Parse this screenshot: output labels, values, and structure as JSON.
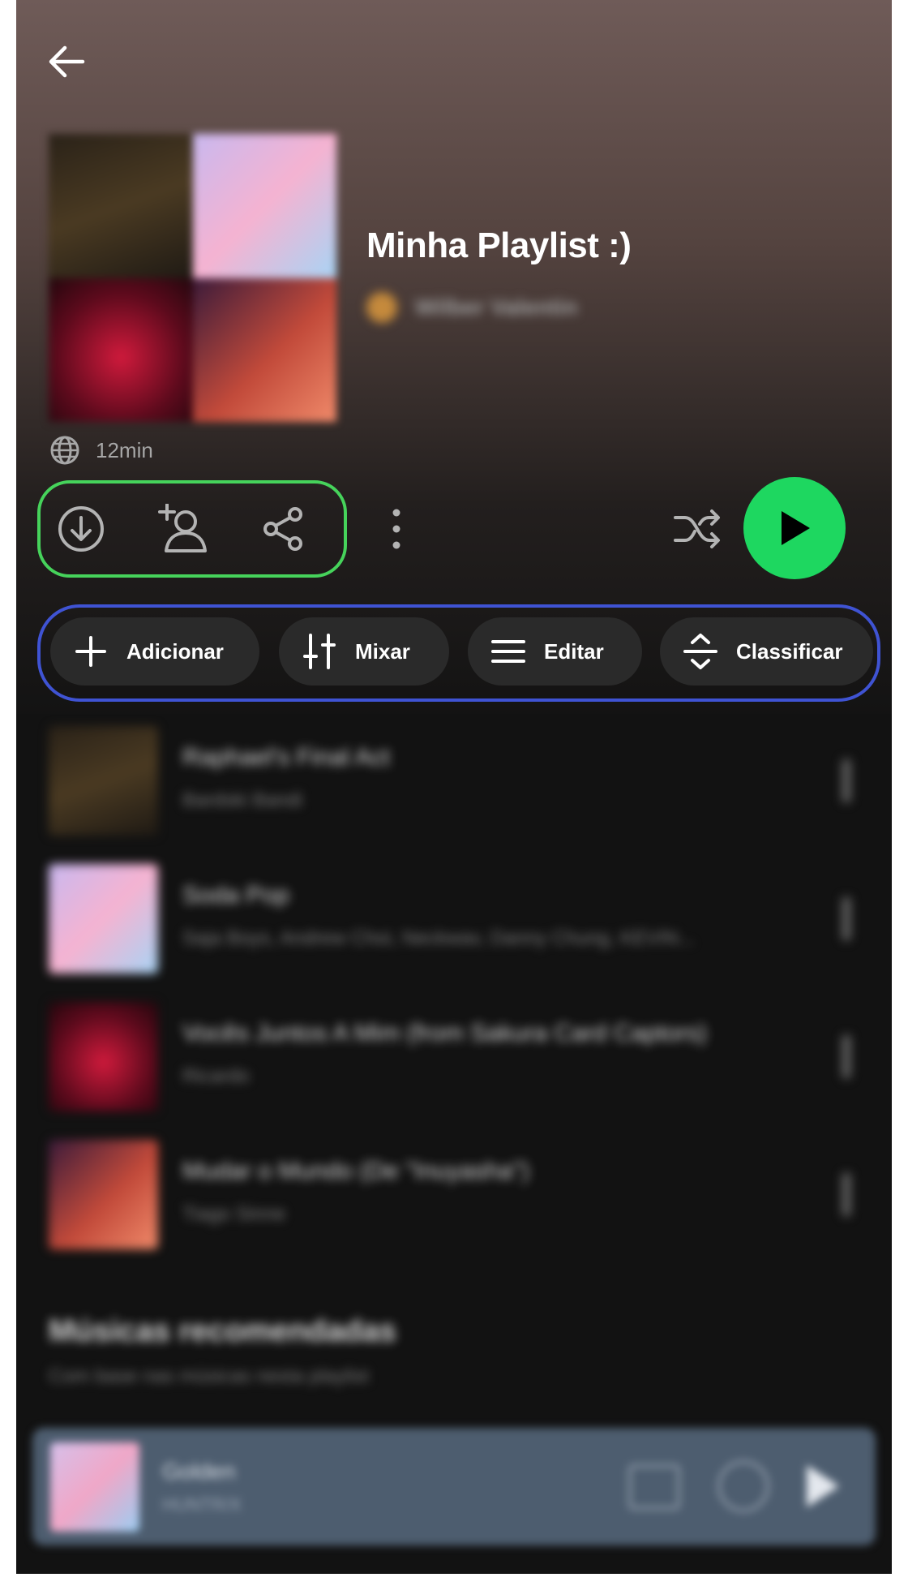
{
  "header": {
    "back_icon": "arrow-left-icon"
  },
  "playlist": {
    "title": "Minha Playlist :)",
    "owner_name": "Wilber Valentin",
    "duration": "12min",
    "visibility_icon": "globe-icon"
  },
  "actions": {
    "download_icon": "download-icon",
    "add_collaborator_icon": "add-user-icon",
    "share_icon": "share-icon",
    "more_icon": "more-vertical-icon",
    "shuffle_icon": "shuffle-icon",
    "play_icon": "play-icon"
  },
  "chips": [
    {
      "label": "Adicionar",
      "icon": "plus-icon"
    },
    {
      "label": "Mixar",
      "icon": "sliders-icon"
    },
    {
      "label": "Editar",
      "icon": "list-icon"
    },
    {
      "label": "Classificar",
      "icon": "sort-icon"
    }
  ],
  "tracks": [
    {
      "title": "Raphael's Final Act",
      "artist": "Bardski Bandi"
    },
    {
      "title": "Soda Pop",
      "artist": "Saja Boys, Andrew Choi, Neckwav, Danny Chung, KEVIN..."
    },
    {
      "title": "Vocês Juntos A Mim (from Sakura Card Captors)",
      "artist": "Ricardo"
    },
    {
      "title": "Mudar o Mundo (De \"Inuyasha\")",
      "artist": "Tiago Sinne"
    }
  ],
  "recommended": {
    "heading": "Músicas recomendadas",
    "subtitle": "Com base nas músicas nesta playlist"
  },
  "mini_player": {
    "title": "Golden",
    "artist": "HUNTR/X"
  },
  "colors": {
    "accent_green": "#1ed760",
    "highlight_green": "#46d35b",
    "highlight_blue": "#3f53d3",
    "chip_bg": "#2a2a2a"
  }
}
